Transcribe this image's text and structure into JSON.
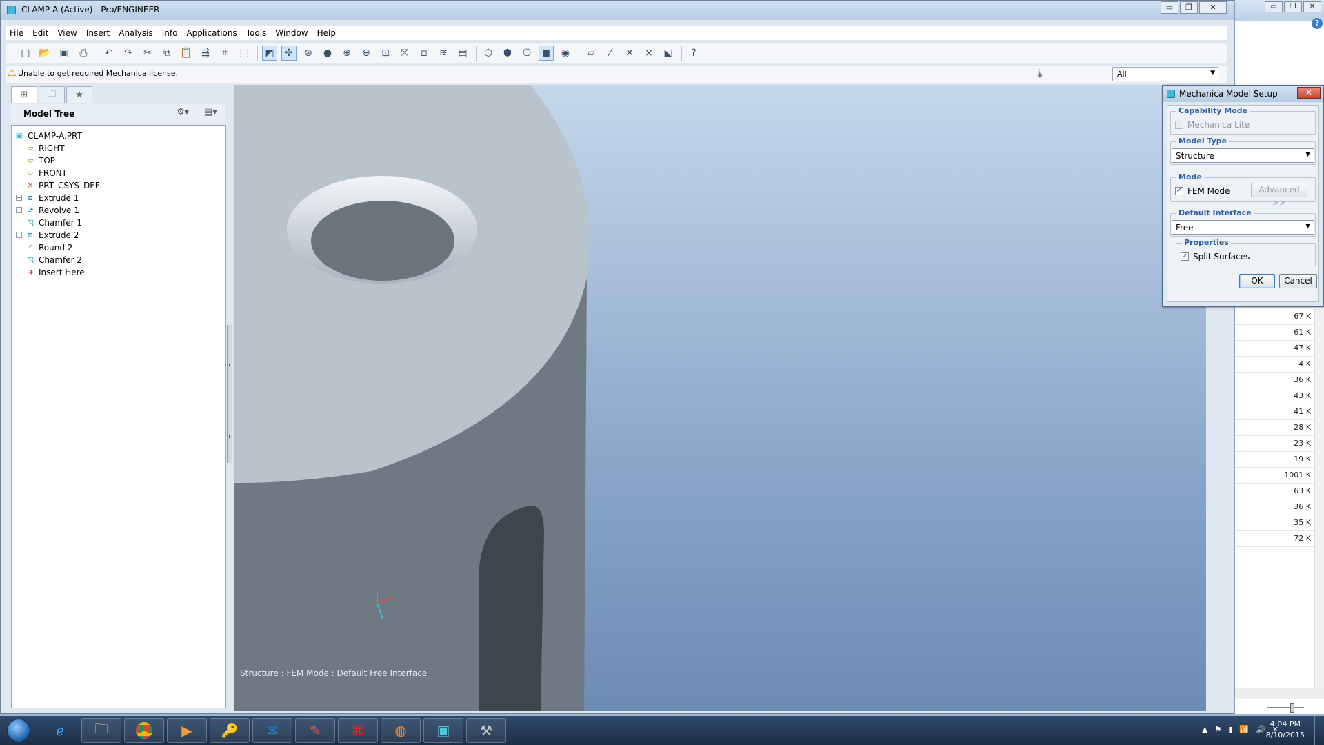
{
  "app": {
    "title": "CLAMP-A (Active) - Pro/ENGINEER",
    "window_controls": [
      "▭",
      "❐",
      "✕"
    ]
  },
  "menu": [
    "File",
    "Edit",
    "View",
    "Insert",
    "Analysis",
    "Info",
    "Applications",
    "Tools",
    "Window",
    "Help"
  ],
  "toolbar_icons": [
    "new-icon",
    "open-icon",
    "save-icon",
    "print-icon",
    "undo-icon",
    "redo-icon",
    "cut-icon",
    "copy-icon",
    "paste-icon",
    "regenerate-icon",
    "find-icon",
    "select-box-icon",
    "datum-display-icon",
    "spin-center-icon",
    "orient-icon",
    "shading-icon",
    "zoom-in-icon",
    "zoom-out-icon",
    "refit-icon",
    "reorient-icon",
    "saved-views-icon",
    "layers-icon",
    "view-manager-icon",
    "wireframe-icon",
    "hidden-line-icon",
    "no-hidden-icon",
    "shaded-icon",
    "appearance-icon",
    "datum-planes-icon",
    "datum-axes-icon",
    "datum-points-icon",
    "csys-icon",
    "annotation-icon",
    "context-help-icon"
  ],
  "message": {
    "text": "Unable to get required Mechanica license.",
    "filter": "All"
  },
  "model_tree": {
    "title": "Model Tree",
    "items": [
      {
        "label": "CLAMP-A.PRT",
        "icon": "part-icon",
        "expandable": false
      },
      {
        "label": "RIGHT",
        "icon": "datum-plane-icon",
        "expandable": false
      },
      {
        "label": "TOP",
        "icon": "datum-plane-icon",
        "expandable": false
      },
      {
        "label": "FRONT",
        "icon": "datum-plane-icon",
        "expandable": false
      },
      {
        "label": "PRT_CSYS_DEF",
        "icon": "csys-icon",
        "expandable": false
      },
      {
        "label": "Extrude 1",
        "icon": "extrude-icon",
        "expandable": true
      },
      {
        "label": "Revolve 1",
        "icon": "revolve-icon",
        "expandable": true
      },
      {
        "label": "Chamfer 1",
        "icon": "chamfer-icon",
        "expandable": false
      },
      {
        "label": "Extrude 2",
        "icon": "extrude-icon",
        "expandable": true
      },
      {
        "label": "Round 2",
        "icon": "round-icon",
        "expandable": false
      },
      {
        "label": "Chamfer 2",
        "icon": "chamfer-icon",
        "expandable": false
      },
      {
        "label": "Insert Here",
        "icon": "insert-arrow-icon",
        "expandable": false
      }
    ]
  },
  "graphics": {
    "status": "Structure : FEM Mode : Default Free Interface"
  },
  "dialog": {
    "title": "Mechanica Model Setup",
    "capability_group": "Capability Mode",
    "mechanica_lite": "Mechanica Lite",
    "mechanica_lite_checked": false,
    "model_type_group": "Model Type",
    "model_type": "Structure",
    "mode_group": "Mode",
    "fem_mode": "FEM Mode",
    "fem_mode_checked": true,
    "advanced_button": "Advanced >>",
    "interface_group": "Default Interface",
    "interface": "Free",
    "properties_group": "Properties",
    "split_surfaces": "Split Surfaces",
    "split_surfaces_checked": true,
    "ok": "OK",
    "cancel": "Cancel"
  },
  "background_list": [
    "67 K",
    "61 K",
    "47 K",
    "4 K",
    "36 K",
    "43 K",
    "41 K",
    "28 K",
    "23 K",
    "19 K",
    "1001 K",
    "63 K",
    "36 K",
    "35 K",
    "72 K"
  ],
  "taskbar": {
    "apps": [
      "internet-explorer-icon",
      "file-explorer-icon",
      "chrome-icon",
      "media-player-icon",
      "keys-icon",
      "outlook-icon",
      "paint-icon",
      "acrobat-icon",
      "firefox-icon",
      "proengineer-icon",
      "tools-icon"
    ],
    "time": "4:04 PM",
    "date": "8/10/2015"
  }
}
